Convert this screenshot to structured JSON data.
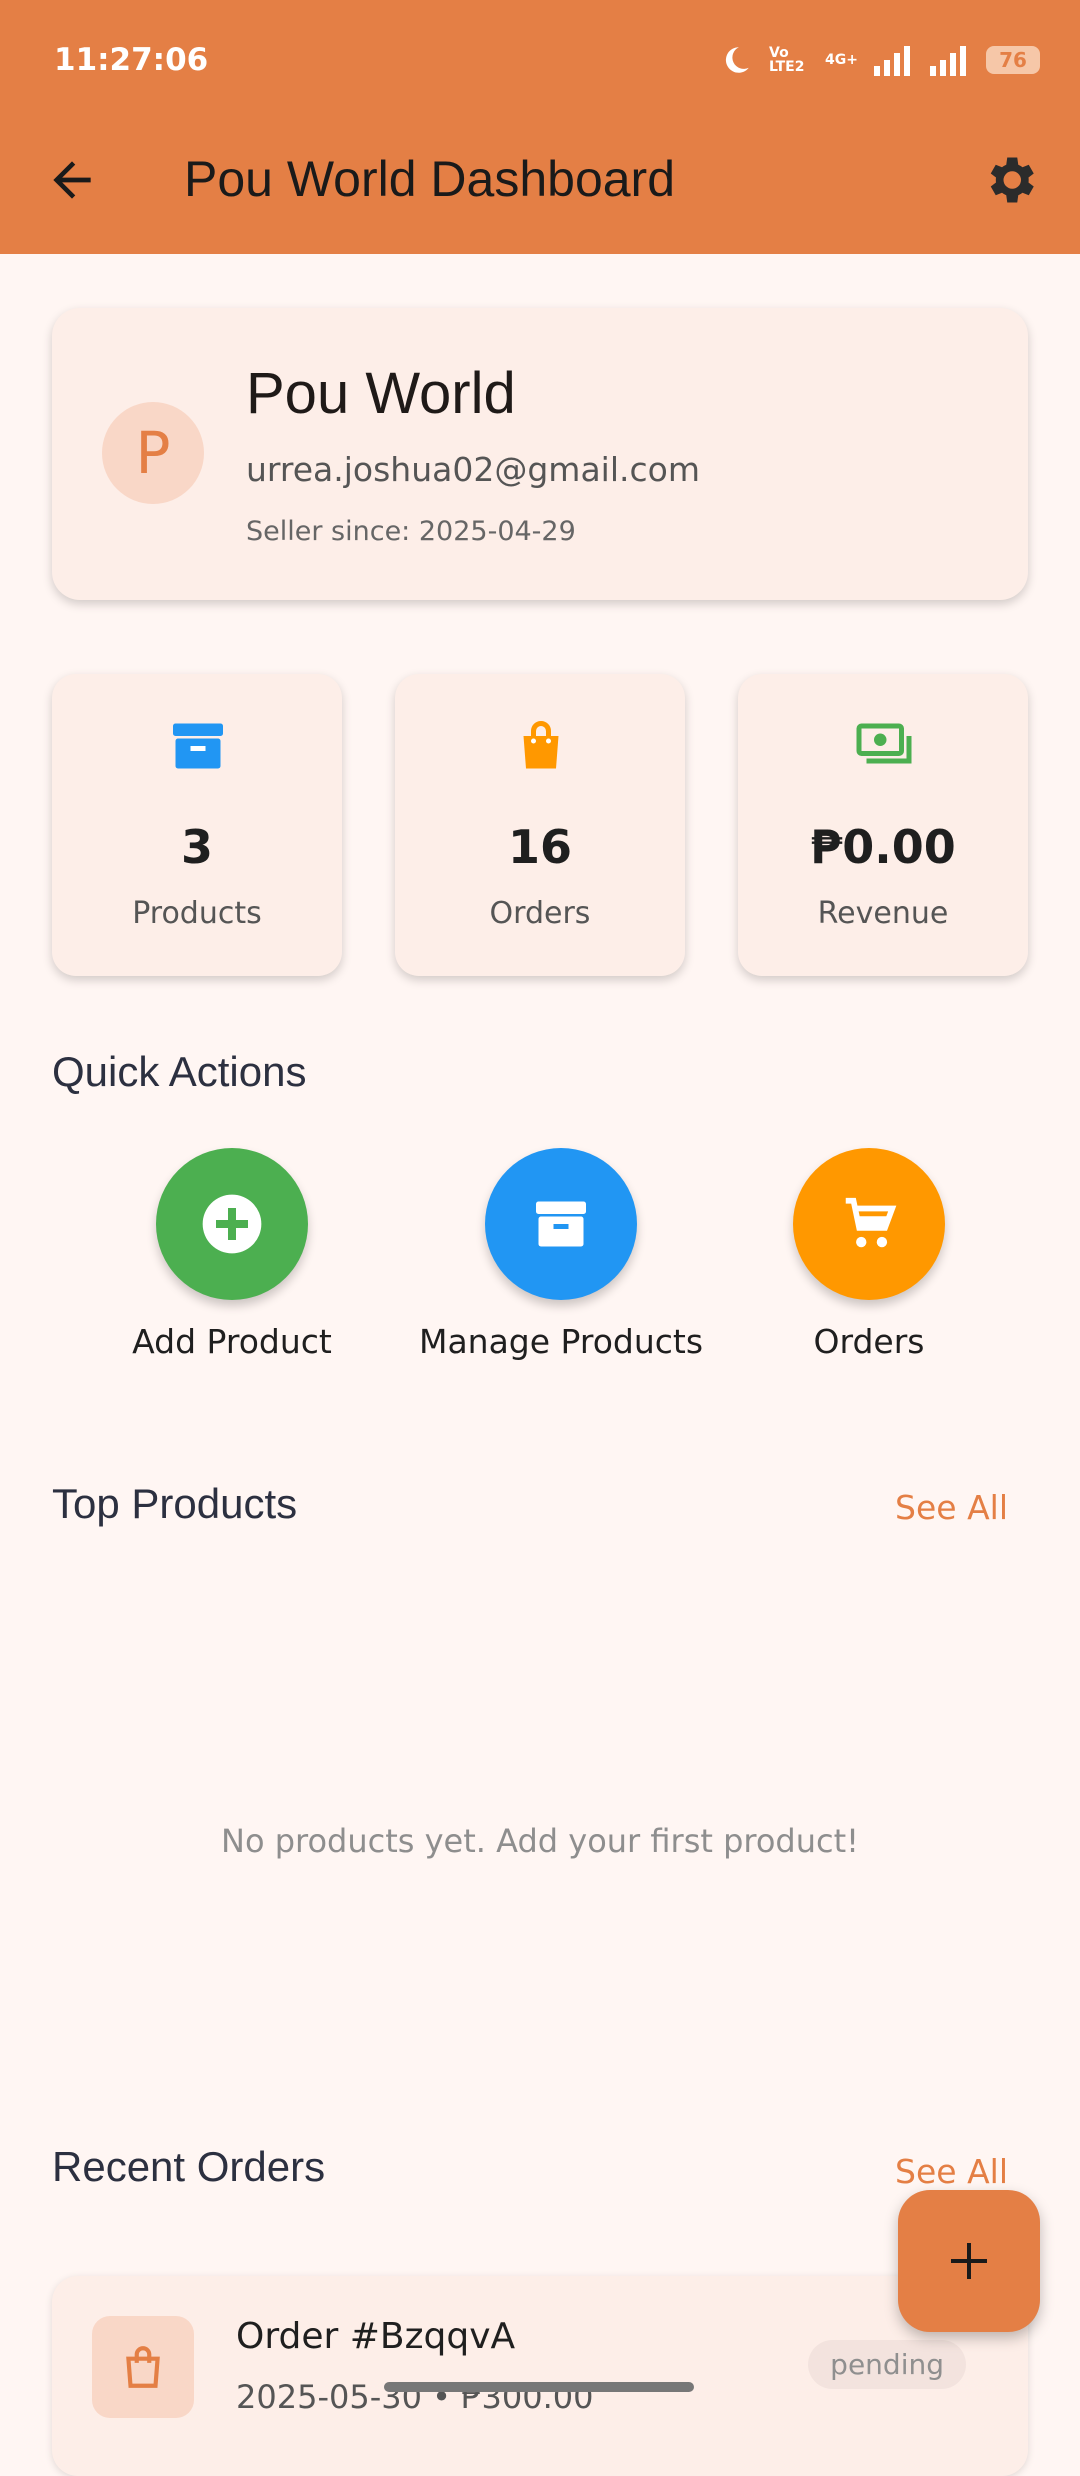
{
  "status_bar": {
    "time": "11:27:06",
    "network_label": "Vo LTE2",
    "network_type": "4G+",
    "battery": "76"
  },
  "app_bar": {
    "title": "Pou World Dashboard"
  },
  "profile": {
    "initial": "P",
    "name": "Pou World",
    "email": "urrea.joshua02@gmail.com",
    "seller_since": "Seller since: 2025-04-29"
  },
  "stats": [
    {
      "value": "3",
      "label": "Products",
      "icon": "archive-icon",
      "color": "#2196F3"
    },
    {
      "value": "16",
      "label": "Orders",
      "icon": "shopping-bag-icon",
      "color": "#FF9800"
    },
    {
      "value": "₱0.00",
      "label": "Revenue",
      "icon": "money-icon",
      "color": "#4CAF50"
    }
  ],
  "quick_actions": {
    "title": "Quick Actions",
    "items": [
      {
        "label": "Add Product",
        "icon": "add-circle-icon",
        "color": "#4CAF50"
      },
      {
        "label": "Manage Products",
        "icon": "archive-icon",
        "color": "#2196F3"
      },
      {
        "label": "Orders",
        "icon": "cart-icon",
        "color": "#FF9800"
      }
    ]
  },
  "top_products": {
    "title": "Top Products",
    "see_all": "See All",
    "empty_message": "No products yet. Add your first product!"
  },
  "recent_orders": {
    "title": "Recent Orders",
    "see_all": "See All",
    "orders": [
      {
        "title": "Order #BzqqvA",
        "subtitle": "2025-05-30 • ₱300.00",
        "status": "pending"
      }
    ]
  },
  "colors": {
    "primary": "#E47F45",
    "background": "#FFF6F3",
    "card": "#FDEEE8"
  }
}
